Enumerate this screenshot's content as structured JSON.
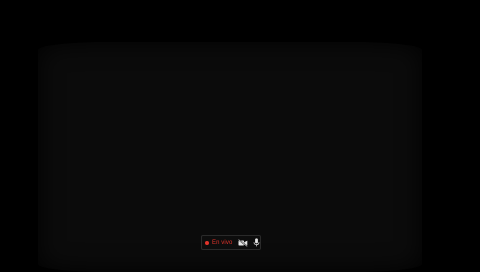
{
  "live_status": {
    "label": "En vivo",
    "dot_color": "#e0342b"
  },
  "controls": {
    "camera_icon": "camera-off-icon",
    "mic_icon": "microphone-icon"
  }
}
